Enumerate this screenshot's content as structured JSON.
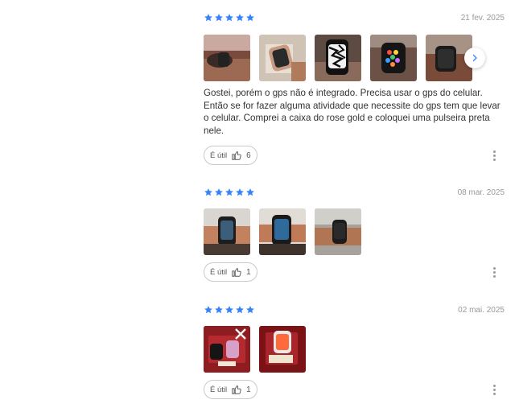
{
  "reviews": [
    {
      "rating": 5,
      "date": "21 fev. 2025",
      "photo_count": 5,
      "text": "Gostei, porém o gps não é integrado. Precisa usar o gps do celular. Então se for fazer alguma atividade que necessite do gps tem que levar o celular. Comprei a caixa do rose gold e coloquei uma pulseira preta nele.",
      "helpful_label": "É útil",
      "helpful_count": "6"
    },
    {
      "rating": 5,
      "date": "08 mar. 2025",
      "photo_count": 3,
      "text": "",
      "helpful_label": "É útil",
      "helpful_count": "1"
    },
    {
      "rating": 5,
      "date": "02 mai. 2025",
      "photo_count": 2,
      "text": "",
      "helpful_label": "É útil",
      "helpful_count": "1"
    }
  ],
  "colors": {
    "star": "#3483fa",
    "accent": "#3483fa",
    "text": "#333333",
    "muted": "#999999"
  },
  "icons": {
    "star": "star-icon",
    "next": "chevron-right-icon",
    "helpful": "thumbs-up-icon",
    "more": "more-vertical-icon"
  }
}
